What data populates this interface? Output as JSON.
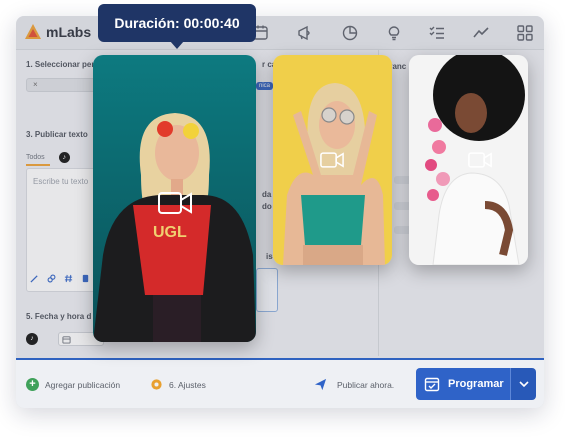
{
  "app": {
    "logo_text": "mLabs",
    "nav_icons": [
      "calendar-icon",
      "megaphone-icon",
      "pie-chart-icon",
      "lightbulb-icon",
      "checklist-icon",
      "trend-line-icon",
      "grid-icon"
    ]
  },
  "form": {
    "section1_label": "1. Seleccionar perí",
    "section1_right_fragment": "r can",
    "chip_label": "×",
    "section3_label": "3. Publicar texto",
    "tabs": [
      "Todos"
    ],
    "textarea_placeholder": "Escribe tu texto",
    "section5_label": "5. Fecha y hora d",
    "right_fragments": [
      "da",
      "do",
      "is"
    ],
    "tool_icons": [
      "magic-icon",
      "link-icon",
      "hashtag-icon",
      "file-icon"
    ],
    "badge_fragment": "nica",
    "right_edge_fragment": "vanc"
  },
  "bottombar": {
    "add_label": "Agregar publicación",
    "settings_label": "6. Ajustes",
    "publish_now_label": "Publicar ahora.",
    "program_label": "Programar"
  },
  "tooltip": {
    "text": "Duración: 00:00:40"
  },
  "colors": {
    "accent_blue": "#2f63c8",
    "tooltip_navy": "#1f3566",
    "brand_orange": "#f0a030",
    "card1_bg": "#0f6f78",
    "card2_bg": "#f2d14a",
    "card3_bg": "#f3f3f3"
  }
}
